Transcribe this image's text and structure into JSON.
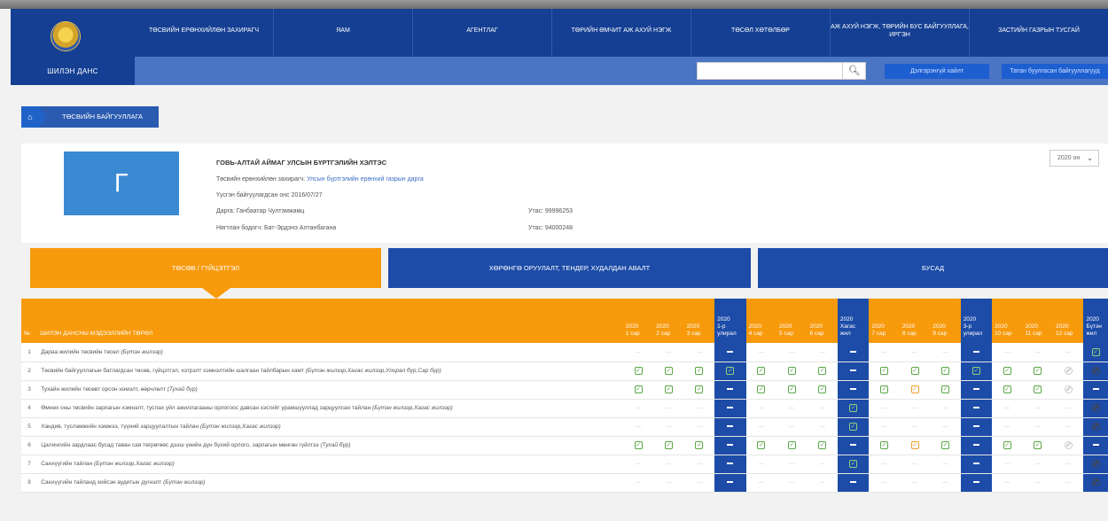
{
  "header": {
    "logo_text": "ШИЛЭН ДАНС",
    "nav": [
      "ТӨСВИЙН ЕРӨНХИЙЛӨН ЗАХИРАГЧ",
      "ЯАМ",
      "АГЕНТЛАГ",
      "ТӨРИЙН ӨМЧИТ АЖ АХУЙ НЭГЖ",
      "ТӨСӨЛ ХӨТӨЛБӨР",
      "АЖ АХУЙ НЭГЖ, ТӨРИЙН БУС БАЙГУУЛЛАГА, ИРГЭН",
      "ЗАСТИЙН ГАЗРЫН ТУСГАЙ"
    ],
    "search_placeholder": "",
    "search_icon": "search-icon",
    "advanced_search": "Дэлгэрэнгүй хайлт",
    "download_report": "Татан буулгасан байгууллагууд"
  },
  "breadcrumb": {
    "home_icon": "home-icon",
    "label": "ТӨСВИЙН БАЙГУУЛЛАГА"
  },
  "org": {
    "logo_letter": "Г",
    "name": "ГОВЬ-АЛТАЙ АЙМАГ УЛСЫН БҮРТГЭЛИЙН ХЭЛТЭС",
    "manager_label": "Төсвийн ерөнхийлөн захирагч: ",
    "manager_value": "Улсын бүртгэлийн ерөнхий газрын дарга",
    "founded": "Үүсгэн байгуулагдсан онс 2016/07/27",
    "director": "Дарга: Ганбаатар Чултэмжамц",
    "director_phone": "Утас: 99996253",
    "accountant": "Нягтлан бодогч: Бат-Эрдэнэ Алтанбагана",
    "accountant_phone": "Утас: 94000248",
    "year_select": "2020 он"
  },
  "tabs": {
    "active": "ТӨСӨВ / ГҮЙЦЭТГЭЛ",
    "second": "ХӨРӨНГӨ ОРУУЛАЛТ, ТЕНДЕР, ХУДАЛДАН АВАЛТ",
    "third": "БУСАД"
  },
  "table": {
    "headers": {
      "no": "№",
      "title": "ШИЛЭН ДАНСНЫ МЭДЭЭЛЛИЙН ТӨРӨЛ",
      "periods": [
        [
          "2020",
          "1 сар"
        ],
        [
          "2020",
          "2 сар"
        ],
        [
          "2020",
          "3 сар"
        ],
        [
          "2020",
          "1-р",
          "улирал"
        ],
        [
          "2020",
          "4 сар"
        ],
        [
          "2020",
          "5 сар"
        ],
        [
          "2020",
          "6 сар"
        ],
        [
          "2020",
          "Хагас",
          "жил"
        ],
        [
          "2020",
          "7 сар"
        ],
        [
          "2020",
          "8 сар"
        ],
        [
          "2020",
          "9 сар"
        ],
        [
          "2020",
          "3-р",
          "улирал"
        ],
        [
          "2020",
          "10 сар"
        ],
        [
          "2020",
          "11 сар"
        ],
        [
          "2020",
          "12 сар"
        ],
        [
          "2020",
          "Бүтэн",
          "жил"
        ]
      ]
    },
    "rows": [
      {
        "no": "1",
        "text": "Дараа жилийн төсвийн төсөл ",
        "note": "(Бүтэн жилээр)",
        "cells": [
          "-",
          "-",
          "-",
          "-",
          "-",
          "-",
          "-",
          "-",
          "-",
          "-",
          "-",
          "-",
          "-",
          "-",
          "-",
          "c"
        ]
      },
      {
        "no": "2",
        "text": "Төсвийн байгууллагын батлагдсан төсөв, гүйцэтгэл, хэтрэлт хэмнэлтийн шалгаан тайлбарын хамт ",
        "note": "(Бүтэн жилээр,Хагас жилээр,Улирал бүр,Сар бүр)",
        "cells": [
          "c",
          "c",
          "c",
          "c",
          "c",
          "c",
          "c",
          "-",
          "c",
          "c",
          "c",
          "c",
          "c",
          "c",
          "b",
          "b"
        ]
      },
      {
        "no": "3",
        "text": "Тухайн жилийн төсөвт орсон нэмэлт, өөрчлөлт ",
        "note": "(Тухай бүр)",
        "cells": [
          "c",
          "c",
          "c",
          "-",
          "c",
          "c",
          "c",
          "-",
          "c",
          "o",
          "c",
          "-",
          "c",
          "c",
          "b",
          "-"
        ]
      },
      {
        "no": "4",
        "text": "Өмнөх оны төсвийн зарлагын хэмнэлт, туслах үйл ажиллагааны орлогоос давсан хэсгийг урамшууллад зарцуулсан тайлан ",
        "note": "(Бүтэн жилээр,Хагас жилээр)",
        "cells": [
          "-",
          "-",
          "-",
          "-",
          "-",
          "-",
          "-",
          "c",
          "-",
          "-",
          "-",
          "-",
          "-",
          "-",
          "-",
          "b"
        ]
      },
      {
        "no": "5",
        "text": "Хандив, тусламжийн хэмжээ, түүний зарцуулалтын тайлан ",
        "note": "(Бүтэн жилээр,Хагас жилээр)",
        "cells": [
          "-",
          "-",
          "-",
          "-",
          "-",
          "-",
          "-",
          "c",
          "-",
          "-",
          "-",
          "-",
          "-",
          "-",
          "-",
          "b"
        ]
      },
      {
        "no": "6",
        "text": "Цалингийн зардлаас бусад таван сая төгрөгөөс дээш үнийн дүн бүхий орлого, зарлагын мөнгөн гүйлгээ ",
        "note": "(Тухай бүр)",
        "cells": [
          "c",
          "c",
          "c",
          "-",
          "c",
          "c",
          "c",
          "-",
          "c",
          "o",
          "c",
          "-",
          "c",
          "c",
          "b",
          "-"
        ]
      },
      {
        "no": "7",
        "text": "Санхүүгийн тайлан ",
        "note": "(Бүтэн жилээр,Хагас жилээр)",
        "cells": [
          "-",
          "-",
          "-",
          "-",
          "-",
          "-",
          "-",
          "c",
          "-",
          "-",
          "-",
          "-",
          "-",
          "-",
          "-",
          "b"
        ]
      },
      {
        "no": "8",
        "text": "Санхүүгийн тайланд хийсэн аудитын дүгнэлт ",
        "note": "(Бүтэн жилээр)",
        "cells": [
          "-",
          "-",
          "-",
          "-",
          "-",
          "-",
          "-",
          "-",
          "-",
          "-",
          "-",
          "-",
          "-",
          "-",
          "-",
          "b"
        ]
      }
    ]
  }
}
